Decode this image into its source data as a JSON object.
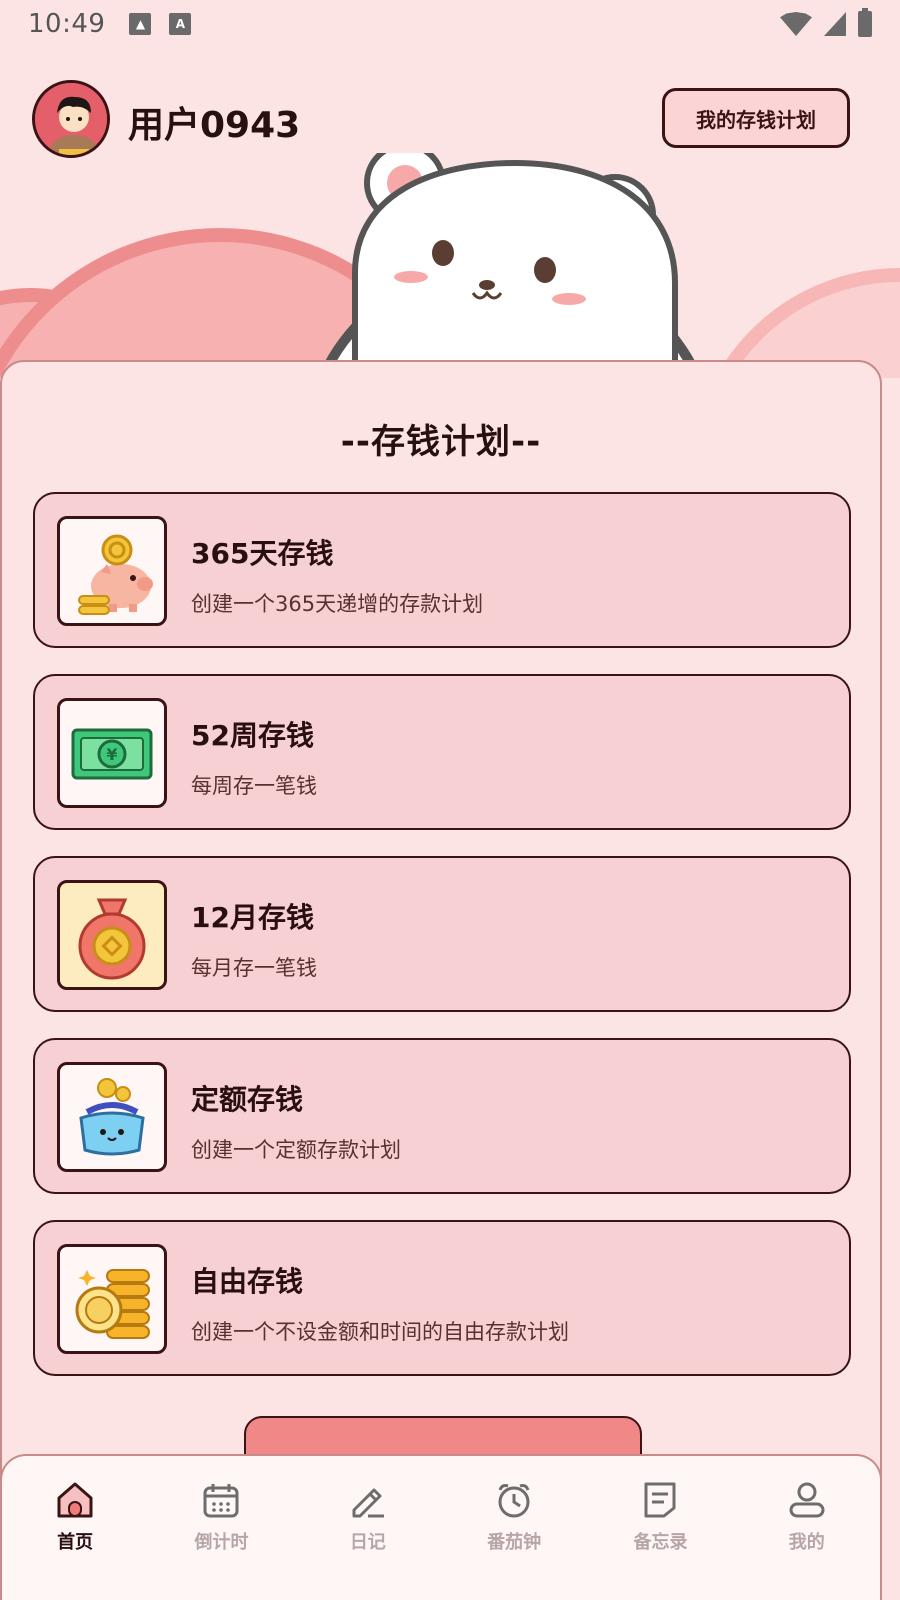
{
  "status_bar": {
    "time": "10:49",
    "icons": [
      "image-icon",
      "text-icon",
      "wifi-icon",
      "cell-signal-icon",
      "battery-icon"
    ]
  },
  "header": {
    "username": "用户0943",
    "my_plan_button": "我的存钱计划"
  },
  "section": {
    "title": "--存钱计划--"
  },
  "plans": [
    {
      "title": "365天存钱",
      "desc": "创建一个365天递增的存款计划",
      "icon": "piggy-bank-icon"
    },
    {
      "title": "52周存钱",
      "desc": "每周存一笔钱",
      "icon": "banknote-icon"
    },
    {
      "title": "12月存钱",
      "desc": "每月存一笔钱",
      "icon": "money-bag-icon"
    },
    {
      "title": "定额存钱",
      "desc": "创建一个定额存款计划",
      "icon": "coin-purse-icon"
    },
    {
      "title": "自由存钱",
      "desc": "创建一个不设金额和时间的自由存款计划",
      "icon": "coin-stack-icon"
    }
  ],
  "tabs": [
    {
      "label": "首页",
      "icon": "home-icon",
      "active": true
    },
    {
      "label": "倒计时",
      "icon": "calendar-icon",
      "active": false
    },
    {
      "label": "日记",
      "icon": "pencil-icon",
      "active": false
    },
    {
      "label": "番茄钟",
      "icon": "alarm-clock-icon",
      "active": false
    },
    {
      "label": "备忘录",
      "icon": "notes-icon",
      "active": false
    },
    {
      "label": "我的",
      "icon": "user-icon",
      "active": false
    }
  ],
  "colors": {
    "background": "#fde4e4",
    "card": "#f6d0d3",
    "accent": "#f08888",
    "text_dark": "#2a0f0f"
  }
}
